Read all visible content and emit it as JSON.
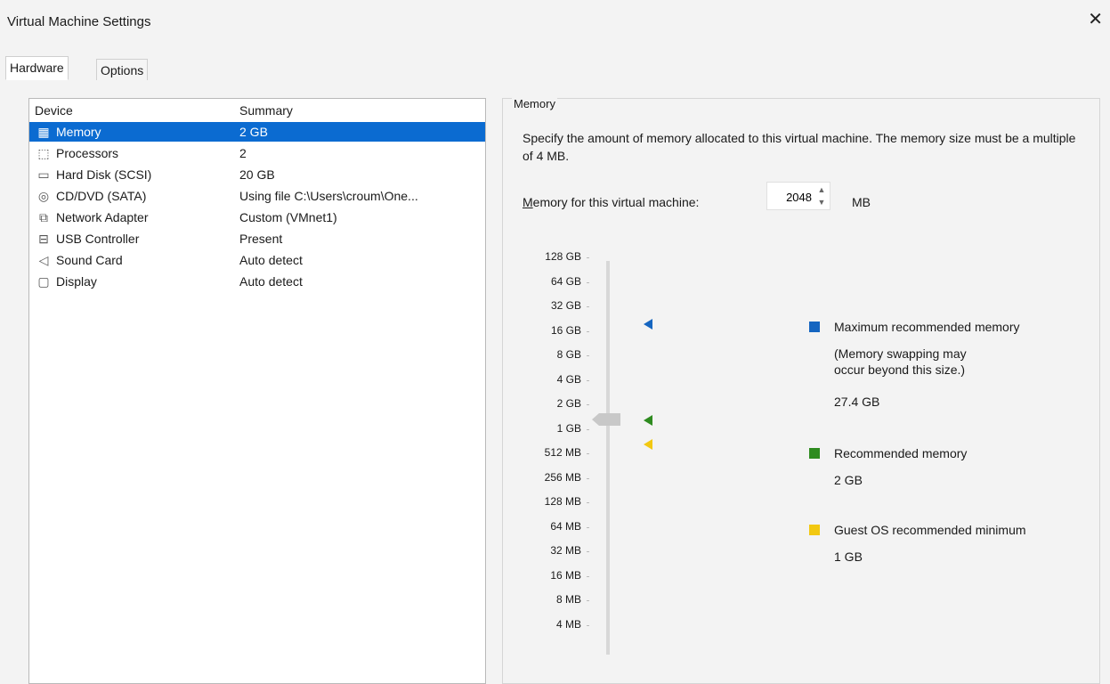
{
  "window": {
    "title": "Virtual Machine Settings",
    "close_glyph": "✕"
  },
  "tabs": [
    {
      "label": "Hardware"
    },
    {
      "label": "Options"
    }
  ],
  "devices": {
    "header": {
      "device": "Device",
      "summary": "Summary"
    },
    "rows": [
      {
        "name": "Memory",
        "summary": "2 GB",
        "icon": "memory-icon",
        "glyph": "▦",
        "selected": true
      },
      {
        "name": "Processors",
        "summary": "2",
        "icon": "processor-icon",
        "glyph": "⬚"
      },
      {
        "name": "Hard Disk (SCSI)",
        "summary": "20 GB",
        "icon": "hard-disk-icon",
        "glyph": "▭"
      },
      {
        "name": "CD/DVD (SATA)",
        "summary": "Using file C:\\Users\\croum\\One...",
        "icon": "cd-dvd-icon",
        "glyph": "◎"
      },
      {
        "name": "Network Adapter",
        "summary": "Custom (VMnet1)",
        "icon": "network-adapter-icon",
        "glyph": "⧉"
      },
      {
        "name": "USB Controller",
        "summary": "Present",
        "icon": "usb-controller-icon",
        "glyph": "⊟"
      },
      {
        "name": "Sound Card",
        "summary": "Auto detect",
        "icon": "sound-card-icon",
        "glyph": "◁"
      },
      {
        "name": "Display",
        "summary": "Auto detect",
        "icon": "display-icon",
        "glyph": "▢"
      }
    ]
  },
  "memory": {
    "group_title": "Memory",
    "description": "Specify the amount of memory allocated to this virtual machine. The memory size must be a multiple of 4 MB.",
    "field_label_prefix": "M",
    "field_label_rest": "emory for this virtual machine:",
    "value": "2048",
    "unit": "MB",
    "scale_labels": [
      "128 GB",
      "64 GB",
      "32 GB",
      "16 GB",
      "8 GB",
      "4 GB",
      "2 GB",
      "1 GB",
      "512 MB",
      "256 MB",
      "128 MB",
      "64 MB",
      "32 MB",
      "16 MB",
      "8 MB",
      "4 MB"
    ],
    "slider_value": "2 GB",
    "legend": {
      "max": {
        "label": "Maximum recommended memory",
        "note_line1": "(Memory swapping may",
        "note_line2": "occur beyond this size.)",
        "value": "27.4 GB",
        "color": "#1565c0"
      },
      "recommended": {
        "label": "Recommended memory",
        "value": "2 GB",
        "color": "#2e8b1f"
      },
      "guest_min": {
        "label": "Guest OS recommended minimum",
        "value": "1 GB",
        "color": "#f2c811"
      }
    }
  }
}
